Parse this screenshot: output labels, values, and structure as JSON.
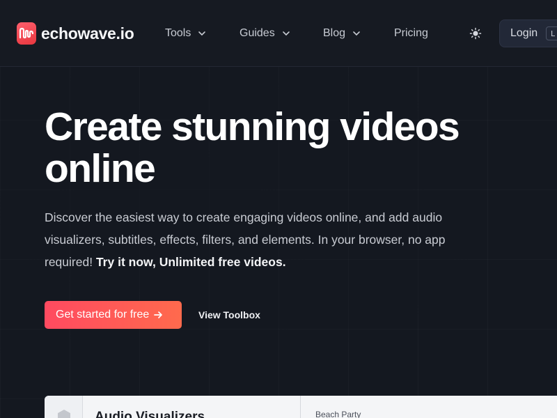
{
  "brand": {
    "name": "echowave.io",
    "icon": "waveform-logo-icon",
    "accent": "#ff4a60"
  },
  "nav": {
    "items": [
      {
        "label": "Tools",
        "has_dropdown": true
      },
      {
        "label": "Guides",
        "has_dropdown": true
      },
      {
        "label": "Blog",
        "has_dropdown": true
      },
      {
        "label": "Pricing",
        "has_dropdown": false
      }
    ],
    "theme_toggle_icon": "sun-icon",
    "login": {
      "label": "Login",
      "shortcut": "L"
    }
  },
  "hero": {
    "title": "Create stunning videos online",
    "description": "Discover the easiest way to create engaging videos online, and add audio visualizers, subtitles, effects, filters, and elements. In your browser, no app required!",
    "description_emphasis": "Try it now, Unlimited free videos.",
    "cta_primary": "Get started for free",
    "cta_primary_icon": "arrow-right-icon",
    "cta_secondary": "View Toolbox"
  },
  "preview": {
    "panel_title": "Audio Visualizers",
    "sidebar_icon": "hexagon-icon",
    "canvas_label": "Beach Party"
  }
}
